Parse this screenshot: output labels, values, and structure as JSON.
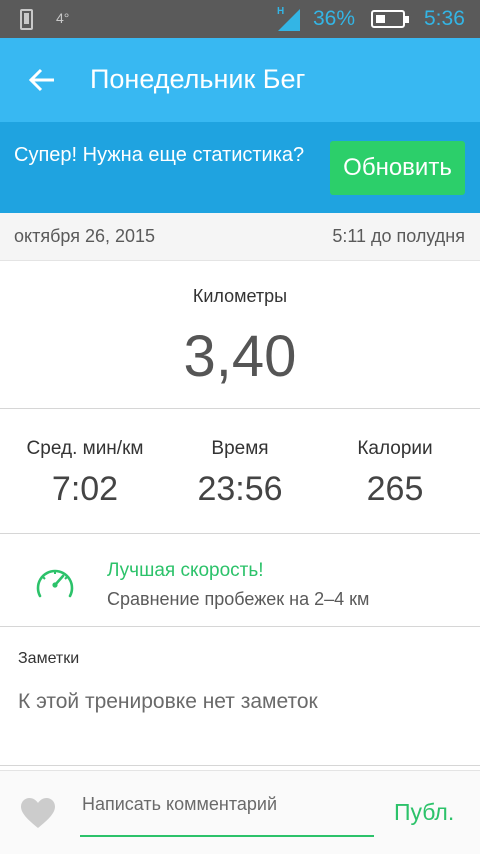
{
  "status_bar": {
    "temperature": "4°",
    "network": "H",
    "battery_percent": "36%",
    "battery_level": 0.36,
    "time": "5:36",
    "accent_color": "#33b5e5"
  },
  "app_bar": {
    "title": "Понедельник Бег",
    "back_icon": "arrow-back-icon",
    "color": "#38b8f2"
  },
  "promo": {
    "text": "Супер! Нужна еще статистика?",
    "button_label": "Обновить",
    "button_color": "#2ccf6a"
  },
  "run_info": {
    "date": "октября 26, 2015",
    "time": "5:11 до полудня"
  },
  "distance": {
    "label": "Километры",
    "value": "3,40"
  },
  "stats": [
    {
      "label": "Сред. мин/км",
      "value": "7:02"
    },
    {
      "label": "Время",
      "value": "23:56"
    },
    {
      "label": "Калории",
      "value": "265"
    }
  ],
  "achievement": {
    "icon": "speedometer-icon",
    "title": "Лучшая скорость!",
    "subtitle": "Сравнение пробежек на 2–4 км",
    "color": "#2cc26a"
  },
  "notes": {
    "label": "Заметки",
    "empty_text": "К этой тренировке нет заметок"
  },
  "comment": {
    "like_icon": "heart-icon",
    "placeholder": "Написать комментарий",
    "value": "",
    "publish_label": "Публ."
  }
}
